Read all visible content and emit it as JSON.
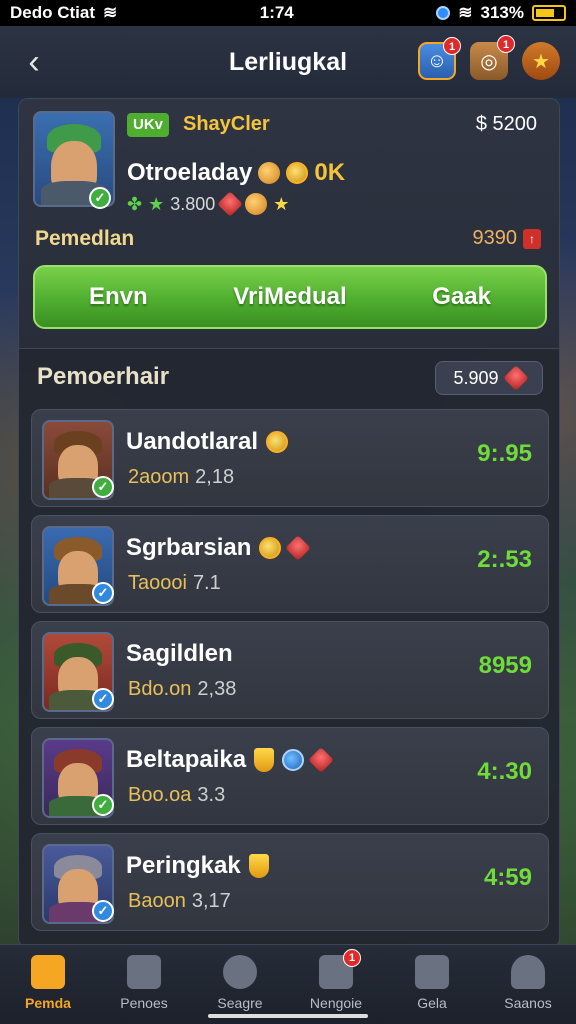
{
  "status_bar": {
    "carrier": "Dedo Ctiat",
    "time": "1:74",
    "battery": "313%"
  },
  "header": {
    "title": "Lerliugkal",
    "notif_1": "1",
    "notif_2": "1"
  },
  "profile": {
    "level_badge": "UKv",
    "tag": "ShayCler",
    "balance": "$ 5200",
    "name": "Otroeladay",
    "name_suffix": "0K",
    "stats": "3.800",
    "level_label": "Pemedlan",
    "level_value": "9390"
  },
  "actions": {
    "left": "Envn",
    "center": "VriMedual",
    "right": "Gaak"
  },
  "section": {
    "title": "Pemoerhair",
    "value": "5.909"
  },
  "rows": [
    {
      "name": "Uandotlaral",
      "sub_label": "2aoom",
      "sub_value": "2,18",
      "score": "9:.95",
      "check": "green"
    },
    {
      "name": "Sgrbarsian",
      "sub_label": "Taoooi",
      "sub_value": "7.1",
      "score": "2:.53",
      "check": "blue"
    },
    {
      "name": "Sagildlen",
      "sub_label": "Bdo.on",
      "sub_value": "2,38",
      "score": "8959",
      "check": "blue"
    },
    {
      "name": "Beltapaika",
      "sub_label": "Boo.oa",
      "sub_value": "3.3",
      "score": "4:.30",
      "check": "green"
    },
    {
      "name": "Peringkak",
      "sub_label": "Baoon",
      "sub_value": "3,17",
      "score": "4:59",
      "check": "blue"
    }
  ],
  "nav": [
    {
      "label": "Pemda",
      "icon": "home-icon"
    },
    {
      "label": "Penoes",
      "icon": "shop-icon"
    },
    {
      "label": "Seagre",
      "icon": "refresh-icon"
    },
    {
      "label": "Nengoie",
      "icon": "inbox-icon",
      "badge": "1"
    },
    {
      "label": "Gela",
      "icon": "guild-icon"
    },
    {
      "label": "Saanos",
      "icon": "profile-icon"
    }
  ]
}
